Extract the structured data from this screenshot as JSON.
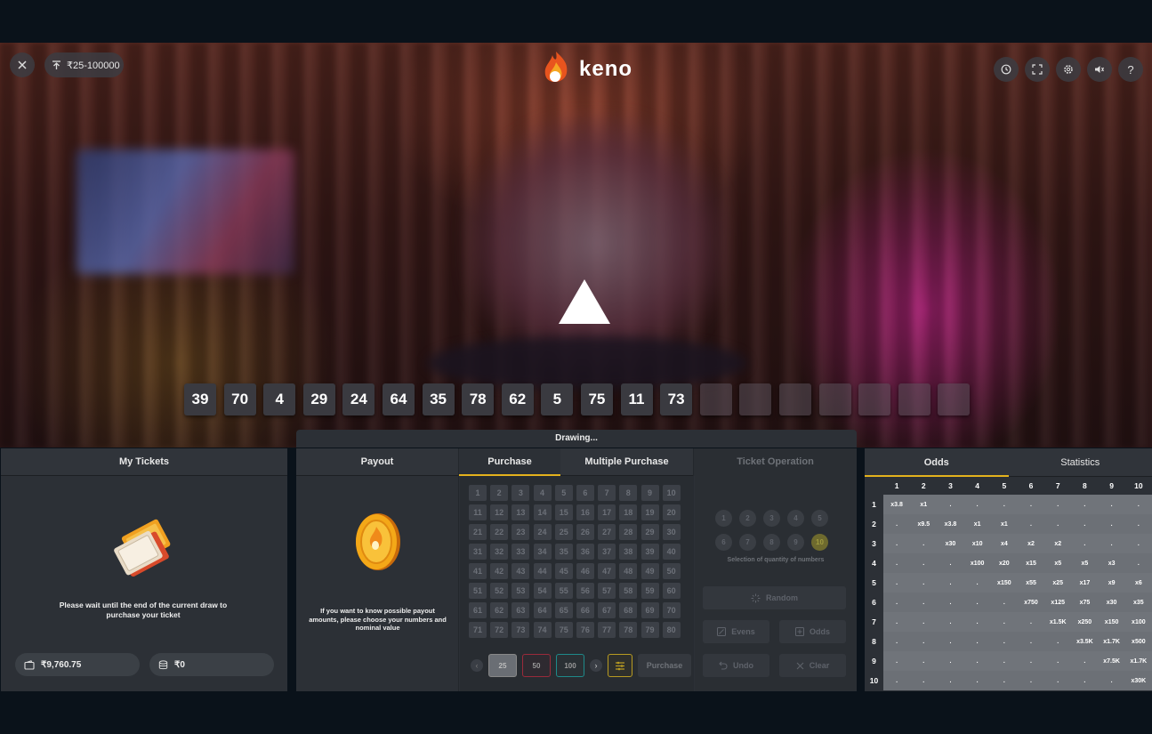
{
  "header": {
    "bet_limit": "₹25-100000",
    "logo_text": "keno"
  },
  "top_icons": [
    "close-icon",
    "upload-icon",
    "history-icon",
    "fullscreen-icon",
    "settings-icon",
    "sound-icon",
    "help-icon"
  ],
  "drawn_balls": [
    "39",
    "70",
    "4",
    "29",
    "24",
    "64",
    "35",
    "78",
    "62",
    "5",
    "75",
    "11",
    "73"
  ],
  "empty_ball_slots": 7,
  "status_bar": "Drawing...",
  "my_tickets": {
    "tab": "My Tickets",
    "message": "Please wait until the end of the current draw to purchase your ticket",
    "balance": "₹9,760.75",
    "stake": "₹0"
  },
  "center": {
    "tabs": {
      "payout": "Payout",
      "purchase": "Purchase",
      "multiple_purchase": "Multiple Purchase",
      "ticket_operation": "Ticket Operation"
    },
    "payout_message": "If you want to know possible payout amounts, please choose your numbers and nominal value",
    "chips": [
      "25",
      "50",
      "100"
    ],
    "purchase_button": "Purchase",
    "quantity_caption": "Selection of quantity of numbers",
    "quantity_options": [
      "1",
      "2",
      "3",
      "4",
      "5",
      "6",
      "7",
      "8",
      "9",
      "10"
    ],
    "quantity_selected": "10",
    "buttons": {
      "random": "Random",
      "evens": "Evens",
      "odds": "Odds",
      "undo": "Undo",
      "clear": "Clear"
    }
  },
  "odds_panel": {
    "tabs": {
      "odds": "Odds",
      "statistics": "Statistics"
    },
    "columns": [
      "1",
      "2",
      "3",
      "4",
      "5",
      "6",
      "7",
      "8",
      "9",
      "10"
    ],
    "rows": [
      {
        "label": "1",
        "cells": [
          "x3.8",
          "x1",
          ".",
          ".",
          ".",
          ".",
          ".",
          ".",
          ".",
          "."
        ]
      },
      {
        "label": "2",
        "cells": [
          ".",
          "x9.5",
          "x3.8",
          "x1",
          "x1",
          ".",
          ".",
          ".",
          ".",
          "."
        ]
      },
      {
        "label": "3",
        "cells": [
          ".",
          ".",
          "x30",
          "x10",
          "x4",
          "x2",
          "x2",
          ".",
          ".",
          "."
        ]
      },
      {
        "label": "4",
        "cells": [
          ".",
          ".",
          ".",
          "x100",
          "x20",
          "x15",
          "x5",
          "x5",
          "x3",
          "."
        ]
      },
      {
        "label": "5",
        "cells": [
          ".",
          ".",
          ".",
          ".",
          "x150",
          "x55",
          "x25",
          "x17",
          "x9",
          "x6"
        ]
      },
      {
        "label": "6",
        "cells": [
          ".",
          ".",
          ".",
          ".",
          ".",
          "x750",
          "x125",
          "x75",
          "x30",
          "x35"
        ]
      },
      {
        "label": "7",
        "cells": [
          ".",
          ".",
          ".",
          ".",
          ".",
          ".",
          "x1.5K",
          "x250",
          "x150",
          "x100"
        ]
      },
      {
        "label": "8",
        "cells": [
          ".",
          ".",
          ".",
          ".",
          ".",
          ".",
          ".",
          "x3.5K",
          "x1.7K",
          "x500"
        ]
      },
      {
        "label": "9",
        "cells": [
          ".",
          ".",
          ".",
          ".",
          ".",
          ".",
          ".",
          ".",
          "x7.5K",
          "x1.7K"
        ]
      },
      {
        "label": "10",
        "cells": [
          ".",
          ".",
          ".",
          ".",
          ".",
          ".",
          ".",
          ".",
          ".",
          "x30K"
        ]
      }
    ]
  },
  "colors": {
    "accent": "#e4b21d",
    "panel": "#2c3036",
    "background": "#0a121a"
  }
}
